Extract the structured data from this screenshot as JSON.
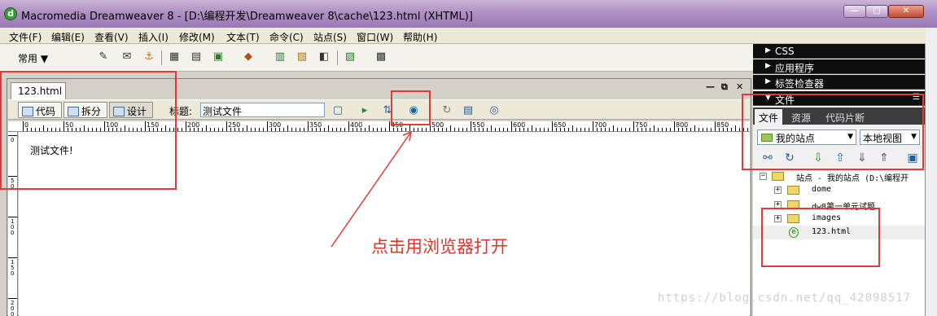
{
  "window": {
    "title": "Macromedia Dreamweaver 8 - [D:\\编程开发\\Dreamweaver 8\\cache\\123.html (XHTML)]",
    "controls": {
      "minimize": "—",
      "maximize": "□",
      "close": "✕"
    }
  },
  "menu": [
    "文件(F)",
    "编辑(E)",
    "查看(V)",
    "插入(I)",
    "修改(M)",
    "文本(T)",
    "命令(C)",
    "站点(S)",
    "窗口(W)",
    "帮助(H)"
  ],
  "insert_bar": {
    "category": "常用 ▼"
  },
  "document": {
    "tab": "123.html",
    "controls": [
      "—",
      "⧉",
      "✕"
    ],
    "views": {
      "code": "代码",
      "split": "拆分",
      "design": "设计"
    },
    "title_label": "标题:",
    "title_value": "测试文件",
    "content": "测试文件!",
    "ruler_labels": [
      "0",
      "50",
      "100",
      "150",
      "200",
      "250",
      "300",
      "350",
      "400",
      "450",
      "500",
      "550",
      "600",
      "650",
      "700",
      "750",
      "800",
      "850"
    ],
    "vruler_labels": [
      "0",
      "50",
      "100",
      "150",
      "200"
    ]
  },
  "panels": {
    "css": "CSS",
    "application": "应用程序",
    "tag_inspector": "标签检查器",
    "files": "文件"
  },
  "files_panel": {
    "tabs": [
      "文件",
      "资源",
      "代码片断"
    ],
    "site": "我的站点",
    "view": "本地视图",
    "tree": [
      {
        "label": "站点 - 我的站点 (D:\\编程开",
        "type": "site",
        "expander": "−"
      },
      {
        "label": "dome",
        "type": "folder",
        "expander": "+"
      },
      {
        "label": "dw8第一单元试题",
        "type": "folder",
        "expander": "+"
      },
      {
        "label": "images",
        "type": "folder",
        "expander": "+"
      },
      {
        "label": "123.html",
        "type": "file",
        "expander": ""
      }
    ]
  },
  "annotation": {
    "text": "点击用浏览器打开",
    "color": "#e0342b"
  },
  "watermark": "https://blog.csdn.net/qq_42098517"
}
